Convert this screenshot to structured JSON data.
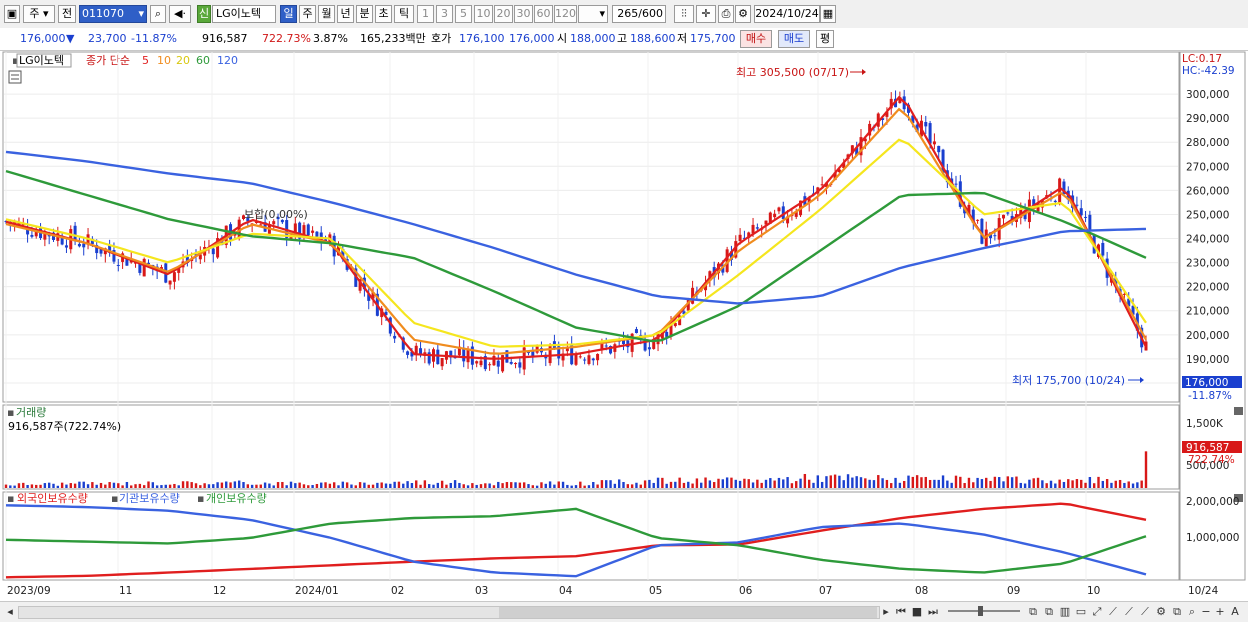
{
  "toolbar": {
    "period_prefix": "주",
    "prev_label": "전",
    "stock_code": "011070",
    "stock_name_badge": "신",
    "stock_name": "LG이노텍",
    "period_buttons": [
      "일",
      "주",
      "월",
      "년",
      "분",
      "초",
      "틱"
    ],
    "interval_buttons": [
      "1",
      "3",
      "5",
      "10",
      "20",
      "30",
      "60",
      "120"
    ],
    "bar_count": "265",
    "bar_total": "/600",
    "date": "2024/10/24"
  },
  "info": {
    "price": "176,000",
    "change_arrow": "▼",
    "change": "23,700",
    "change_pct": "-11.87%",
    "volume": "916,587",
    "volume_ratio": "722.73%",
    "turnover_pct": "3.87%",
    "amount": "165,233백만",
    "quote_label": "호가",
    "ask": "176,100",
    "bid": "176,000",
    "open_label": "시",
    "open": "188,000",
    "high_label": "고",
    "high": "188,600",
    "low_label": "저",
    "low": "175,700",
    "buy_button": "매수",
    "sell_button": "매도",
    "eval_button": "평"
  },
  "price_panel": {
    "title": "LG이노텍",
    "ma_label": "종가 단순",
    "ma_periods": [
      "5",
      "10",
      "20",
      "60",
      "120"
    ],
    "ma_colors": [
      "#e01e1e",
      "#f08c1e",
      "#f5e61e",
      "#2e9a3a",
      "#3a62e0"
    ],
    "annotation_mid": "보합(0.00%)",
    "high_annotation": "최고 305,500 (07/17)",
    "low_annotation": "최저 175,700 (10/24)",
    "lc_label": "LC:0.17",
    "hc_label": "HC:-42.39",
    "price_ticks": [
      "300,000",
      "290,000",
      "280,000",
      "270,000",
      "260,000",
      "250,000",
      "240,000",
      "230,000",
      "220,000",
      "210,000",
      "200,000",
      "190,000",
      "180,000"
    ],
    "current_price_tag": "176,000",
    "current_pct_tag": "-11.87%"
  },
  "volume_panel": {
    "title": "거래량",
    "value": "916,587주(722.74%)",
    "tick_top": "1,500K",
    "tag_value": "916,587",
    "tag_pct": "722.74%",
    "tick_bottom": "500,000"
  },
  "holding_panel": {
    "series": [
      {
        "name": "외국인보유수량",
        "color": "#e01e1e"
      },
      {
        "name": "기관보유수량",
        "color": "#3a62e0"
      },
      {
        "name": "개인보유수량",
        "color": "#2e9a3a"
      }
    ],
    "ticks": [
      "2,000,000",
      "1,000,000"
    ]
  },
  "time_axis": {
    "labels": [
      "2023/09",
      "11",
      "12",
      "2024/01",
      "02",
      "03",
      "04",
      "05",
      "06",
      "07",
      "08",
      "09",
      "10"
    ],
    "right_label": "10/24"
  },
  "chart_data": [
    {
      "type": "line",
      "title": "LG이노텍",
      "subtitle": "종가 단순 5 10 20 60 120",
      "x": [
        "2023/09",
        "10",
        "11",
        "12",
        "2024/01",
        "02",
        "03",
        "04",
        "05",
        "06",
        "07",
        "08",
        "09",
        "10",
        "10/24"
      ],
      "series": [
        {
          "name": "5",
          "values": [
            247000,
            238000,
            225000,
            248000,
            238000,
            192000,
            190000,
            192000,
            198000,
            238000,
            260000,
            300000,
            240000,
            262000,
            195000
          ]
        },
        {
          "name": "10",
          "values": [
            246000,
            238000,
            226000,
            246000,
            238000,
            198000,
            192000,
            195000,
            200000,
            235000,
            258000,
            295000,
            240000,
            260000,
            198000
          ]
        },
        {
          "name": "20",
          "values": [
            248000,
            240000,
            230000,
            242000,
            240000,
            205000,
            195000,
            196000,
            200000,
            225000,
            252000,
            282000,
            250000,
            255000,
            205000
          ]
        },
        {
          "name": "60",
          "values": [
            268000,
            258000,
            248000,
            241000,
            238000,
            232000,
            218000,
            203000,
            197000,
            212000,
            235000,
            258000,
            259000,
            247000,
            232000
          ]
        },
        {
          "name": "120",
          "values": [
            276000,
            272000,
            267000,
            263000,
            255000,
            246000,
            236000,
            225000,
            216000,
            213000,
            216000,
            228000,
            236000,
            243000,
            244000
          ]
        }
      ],
      "ylim": [
        175000,
        310000
      ],
      "annotations": [
        "최고 305,500 (07/17)",
        "최저 175,700 (10/24)"
      ]
    },
    {
      "type": "bar",
      "title": "거래량",
      "x": [
        "2023/09",
        "10",
        "11",
        "12",
        "2024/01",
        "02",
        "03",
        "04",
        "05",
        "06",
        "07",
        "08",
        "09",
        "10",
        "10/24"
      ],
      "values": [
        90000,
        110000,
        120000,
        130000,
        100000,
        150000,
        120000,
        110000,
        180000,
        180000,
        260000,
        220000,
        200000,
        190000,
        916587
      ],
      "ylim": [
        0,
        1700000
      ]
    },
    {
      "type": "line",
      "x": [
        "2023/09",
        "10",
        "11",
        "12",
        "2024/01",
        "02",
        "03",
        "04",
        "05",
        "06",
        "07",
        "08",
        "09",
        "10",
        "10/24"
      ],
      "series": [
        {
          "name": "외국인보유수량",
          "values": [
            20000,
            60000,
            150000,
            250000,
            350000,
            450000,
            540000,
            600000,
            900000,
            920000,
            1300000,
            1650000,
            1900000,
            2050000,
            1600000
          ]
        },
        {
          "name": "기관보유수량",
          "values": [
            2000000,
            1950000,
            1850000,
            1600000,
            1100000,
            450000,
            150000,
            50000,
            900000,
            980000,
            1400000,
            1500000,
            1200000,
            700000,
            100000
          ]
        },
        {
          "name": "개인보유수량",
          "values": [
            1050000,
            1000000,
            950000,
            1100000,
            1500000,
            1650000,
            1700000,
            1900000,
            1100000,
            900000,
            500000,
            250000,
            150000,
            400000,
            1150000
          ]
        }
      ],
      "ylim": [
        0,
        2200000
      ]
    }
  ]
}
